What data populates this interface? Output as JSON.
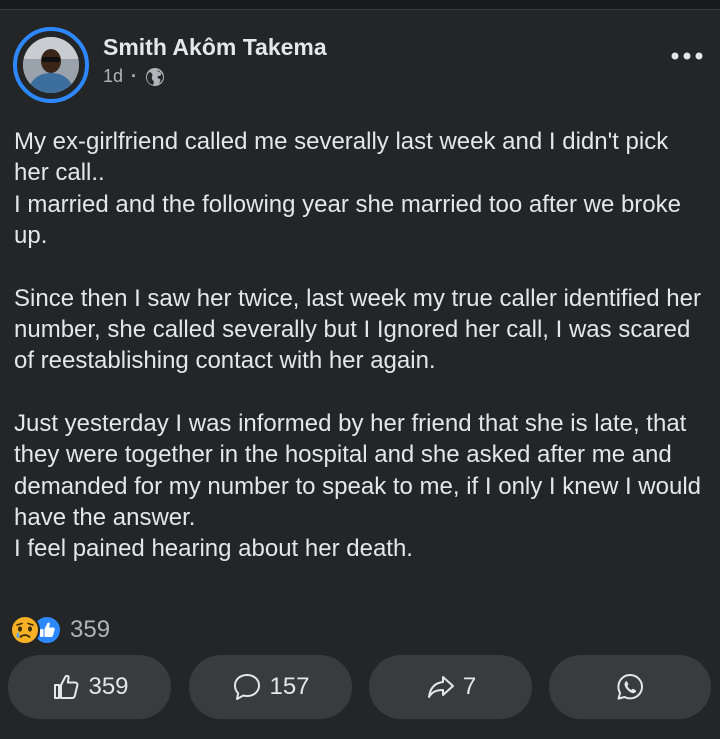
{
  "post": {
    "author": "Smith Akôm Takema",
    "time": "1d",
    "separator": "·",
    "privacy_icon": "globe-icon",
    "more_icon": "more-options-icon",
    "paragraphs": [
      "My ex-girlfriend called me severally last week and I didn't pick her call..\nI married and the following year she married too after we broke up.",
      "Since then I saw her twice, last week my true caller identified her number, she called severally but I Ignored her call, I was scared of reestablishing contact with her again.",
      "Just yesterday I was informed by her friend that she is late, that they were together in the hospital and she asked after me and demanded for my number to speak to me, if I only I knew I would have the answer.\nI feel pained hearing about her death."
    ]
  },
  "reactions": {
    "icons": [
      "sad-reaction-icon",
      "like-reaction-icon"
    ],
    "count": "359"
  },
  "actions": {
    "like": {
      "icon": "thumbs-up-icon",
      "count": "359"
    },
    "comment": {
      "icon": "comment-icon",
      "count": "157"
    },
    "share": {
      "icon": "share-arrow-icon",
      "count": "7"
    },
    "whatsapp": {
      "icon": "whatsapp-icon"
    }
  },
  "colors": {
    "background": "#242526",
    "button": "#3a3b3c",
    "text": "#e4e6eb",
    "secondary_text": "#b0b3b8",
    "accent": "#2d88ff",
    "sad": "#f7b125"
  }
}
